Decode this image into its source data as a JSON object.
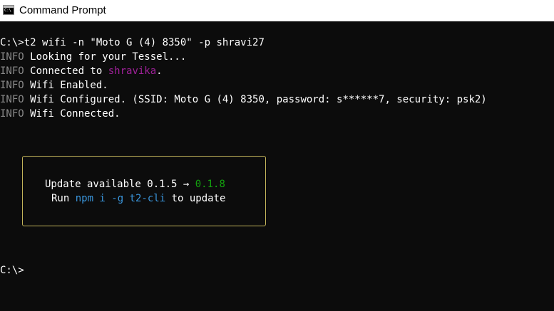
{
  "window": {
    "title": "Command Prompt",
    "icon": "cmd-icon"
  },
  "console": {
    "command_prompt": "C:\\>",
    "command": "t2 wifi -n \"Moto G (4) 8350\" -p shravi27",
    "log_prefix": "INFO",
    "logs": [
      {
        "text": " Looking for your Tessel..."
      },
      {
        "text": " Connected to ",
        "highlight": "shravika",
        "suffix": "."
      },
      {
        "text": " Wifi Enabled."
      },
      {
        "text": " Wifi Configured. (SSID: Moto G (4) 8350, password: s******7, security: psk2)"
      },
      {
        "text": " Wifi Connected."
      }
    ],
    "update_box": {
      "line1_prefix": "Update available ",
      "current_version": "0.1.5",
      "arrow": " → ",
      "new_version": "0.1.8",
      "line2_prefix": "Run ",
      "command": "npm i -g t2-cli",
      "line2_suffix": " to update"
    },
    "final_prompt": "C:\\>"
  },
  "colors": {
    "background": "#0c0c0c",
    "text": "#ffffff",
    "info_prefix": "#8a8a8a",
    "hostname": "#a0219a",
    "new_version": "#13a10e",
    "command_highlight": "#3a96dd",
    "box_border": "#c2b35a"
  }
}
